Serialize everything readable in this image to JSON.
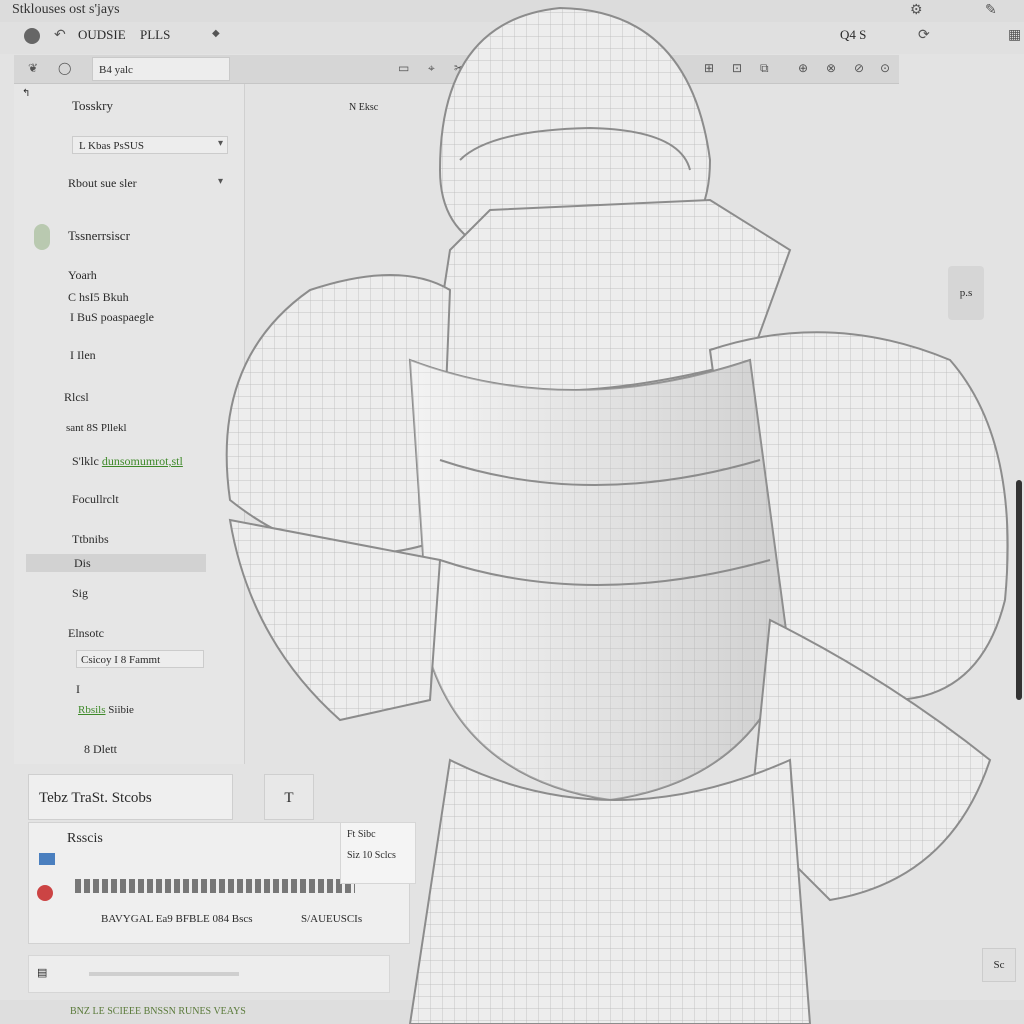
{
  "window": {
    "title": "Stklouses ost s'jays"
  },
  "toolbar": {
    "label_a": "OUDSIE",
    "label_b": "PLLS",
    "right_label": "Q4 S"
  },
  "ribbon": {
    "search_value": "B4 yalc"
  },
  "left_panel": {
    "header_right": "N Eksc",
    "items": [
      {
        "label": "Tosskry"
      },
      {
        "label": "L Kbas PsSUS"
      },
      {
        "label": "Rbout sue sler"
      },
      {
        "label": "Tssnerrsiscr"
      },
      {
        "label": "Yoarh"
      },
      {
        "label": "C hsI5 Bkuh"
      },
      {
        "label": "I BuS poaspaegle"
      },
      {
        "label": "I Ilen"
      },
      {
        "label": "Rlcsl"
      },
      {
        "label": "sant 8S Pllekl"
      },
      {
        "label": "S'lklc",
        "link": "dunsomumrot,stl"
      },
      {
        "label": "Focullrclt"
      },
      {
        "label": "Ttbnibs"
      },
      {
        "label": "Dis",
        "selected": true
      },
      {
        "label": "Sig"
      },
      {
        "label": "Elnsotc"
      },
      {
        "label": "Csicoy I 8 Fammt"
      },
      {
        "label": "I"
      },
      {
        "label": "Siibie",
        "link": "Rbsils"
      },
      {
        "label": "8 Dlett"
      }
    ]
  },
  "tabs": {
    "active": "Tebz TraSt. Stcobs",
    "other": "T"
  },
  "details": {
    "heading": "Rsscis",
    "mini_card_top": "Ft Sibc",
    "mini_card_bottom": "Siz 10 Sclcs",
    "row_text": "BAVYGAL Ea9 BFBLE 084 Bscs",
    "row_right": "S/AUEUSCIs"
  },
  "status": {
    "text": "BNZ LE SCIEEE BNSSN RUNES VEAYS"
  },
  "float_button": "p.s",
  "corner_button": "Sc",
  "colors": {
    "accent": "#3f8a2a",
    "background": "#e3e3e3"
  }
}
